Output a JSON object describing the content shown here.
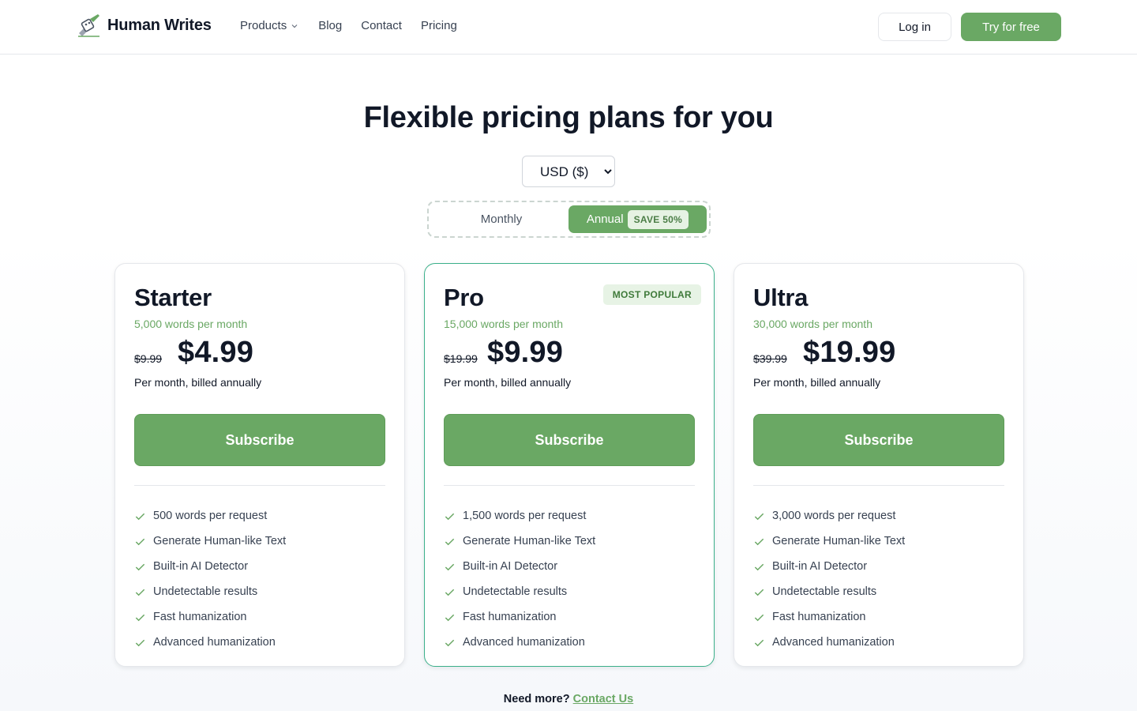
{
  "brand": {
    "name": "Human Writes"
  },
  "nav": {
    "products": "Products",
    "blog": "Blog",
    "contact": "Contact",
    "pricing": "Pricing"
  },
  "header_actions": {
    "login": "Log in",
    "try": "Try for free"
  },
  "hero": {
    "title": "Flexible pricing plans for you"
  },
  "currency": {
    "selected": "USD ($)"
  },
  "billing_toggle": {
    "monthly": "Monthly",
    "annual": "Annual",
    "save": "SAVE 50%",
    "active": "annual"
  },
  "plans": [
    {
      "name": "Starter",
      "words": "5,000 words per month",
      "old_price": "$9.99",
      "price": "$4.99",
      "billing": "Per month, billed annually",
      "cta": "Subscribe",
      "features": [
        "500 words per request",
        "Generate Human-like Text",
        "Built-in AI Detector",
        "Undetectable results",
        "Fast humanization",
        "Advanced humanization"
      ]
    },
    {
      "name": "Pro",
      "badge": "MOST POPULAR",
      "words": "15,000 words per month",
      "old_price": "$19.99",
      "price": "$9.99",
      "billing": "Per month, billed annually",
      "cta": "Subscribe",
      "features": [
        "1,500 words per request",
        "Generate Human-like Text",
        "Built-in AI Detector",
        "Undetectable results",
        "Fast humanization",
        "Advanced humanization"
      ]
    },
    {
      "name": "Ultra",
      "words": "30,000 words per month",
      "old_price": "$39.99",
      "price": "$19.99",
      "billing": "Per month, billed annually",
      "cta": "Subscribe",
      "features": [
        "3,000 words per request",
        "Generate Human-like Text",
        "Built-in AI Detector",
        "Undetectable results",
        "Fast humanization",
        "Advanced humanization"
      ]
    }
  ],
  "footer": {
    "need_more": "Need more?",
    "contact_link": "Contact Us"
  },
  "colors": {
    "accent": "#6aa864",
    "featured_border": "#3bb08a",
    "text": "#111827"
  },
  "icons": {
    "logo": "robot-pen-icon",
    "chevron": "chevron-down-icon",
    "check": "check-icon"
  }
}
